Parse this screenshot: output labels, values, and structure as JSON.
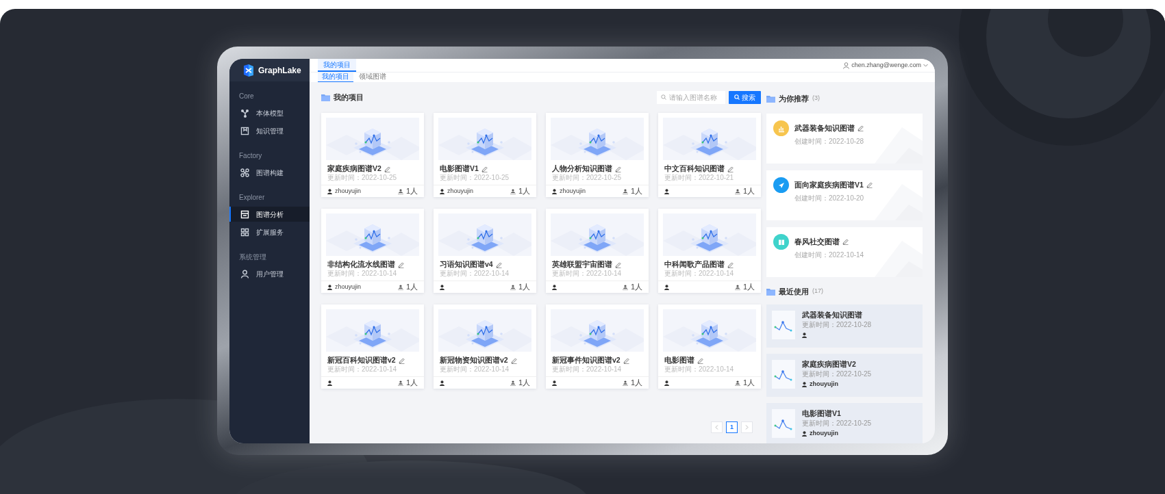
{
  "app": {
    "logo": "GraphLake"
  },
  "sidebar": {
    "sections": [
      {
        "title": "Core",
        "items": [
          {
            "label": "本体模型",
            "selected": false
          },
          {
            "label": "知识管理",
            "selected": false
          }
        ]
      },
      {
        "title": "Factory",
        "items": [
          {
            "label": "图谱构建",
            "selected": false
          }
        ]
      },
      {
        "title": "Explorer",
        "items": [
          {
            "label": "图谱分析",
            "selected": true
          },
          {
            "label": "扩展服务",
            "selected": false
          }
        ]
      },
      {
        "title": "系统管理",
        "items": [
          {
            "label": "用户管理",
            "selected": false
          }
        ]
      }
    ]
  },
  "header": {
    "tabs": [
      {
        "label": "我的项目",
        "selected": true
      }
    ],
    "subtabs": [
      {
        "label": "我的项目",
        "selected": true
      },
      {
        "label": "领域图谱",
        "selected": false
      }
    ],
    "user": "chen.zhang@wenge.com"
  },
  "projects": {
    "title": "我的项目",
    "search": {
      "placeholder": "请输入图谱名称",
      "button": "搜索"
    },
    "cards": [
      {
        "title": "家庭疾病图谱V2",
        "date": "更新时间：2022-10-25",
        "owner": "zhouyujin",
        "members": "1人"
      },
      {
        "title": "电影图谱V1",
        "date": "更新时间：2022-10-25",
        "owner": "zhouyujin",
        "members": "1人"
      },
      {
        "title": "人物分析知识图谱",
        "date": "更新时间：2022-10-25",
        "owner": "zhouyujin",
        "members": "1人"
      },
      {
        "title": "中文百科知识图谱",
        "date": "更新时间：2022-10-21",
        "members": "1人"
      },
      {
        "title": "非结构化流水线图谱",
        "date": "更新时间：2022-10-14",
        "owner": "zhouyujin",
        "members": "1人"
      },
      {
        "title": "习语知识图谱v4",
        "date": "更新时间：2022-10-14",
        "members": "1人"
      },
      {
        "title": "英雄联盟宇宙图谱",
        "date": "更新时间：2022-10-14",
        "members": "1人"
      },
      {
        "title": "中科闻歌产品图谱",
        "date": "更新时间：2022-10-14",
        "members": "1人"
      },
      {
        "title": "新冠百科知识图谱v2",
        "date": "更新时间：2022-10-14",
        "members": "1人"
      },
      {
        "title": "新冠物资知识图谱v2",
        "date": "更新时间：2022-10-14",
        "members": "1人"
      },
      {
        "title": "新冠事件知识图谱v2",
        "date": "更新时间：2022-10-14",
        "members": "1人"
      },
      {
        "title": "电影图谱",
        "date": "更新时间：2022-10-14",
        "members": "1人"
      }
    ],
    "pagination": [
      {
        "label": "1",
        "selected": true
      }
    ]
  },
  "recommend": {
    "title": "为你推荐",
    "count": "(3)",
    "items": [
      {
        "title": "武器装备知识图谱",
        "date": "创建时间：2022-10-28",
        "color": "#f7c54e"
      },
      {
        "title": "面向家庭疾病图谱V1",
        "date": "创建时间：2022-10-20",
        "color": "#1a9cf2"
      },
      {
        "title": "春风社交图谱",
        "date": "创建时间：2022-10-14",
        "color": "#3fd3cb"
      }
    ]
  },
  "recent": {
    "title": "最近使用",
    "count": "(17)",
    "items": [
      {
        "title": "武器装备知识图谱",
        "date": "更新时间：2022-10-28"
      },
      {
        "title": "家庭疾病图谱V2",
        "date": "更新时间：2022-10-25",
        "owner": "zhouyujin"
      },
      {
        "title": "电影图谱V1",
        "date": "更新时间：2022-10-25",
        "owner": "zhouyujin"
      }
    ]
  }
}
